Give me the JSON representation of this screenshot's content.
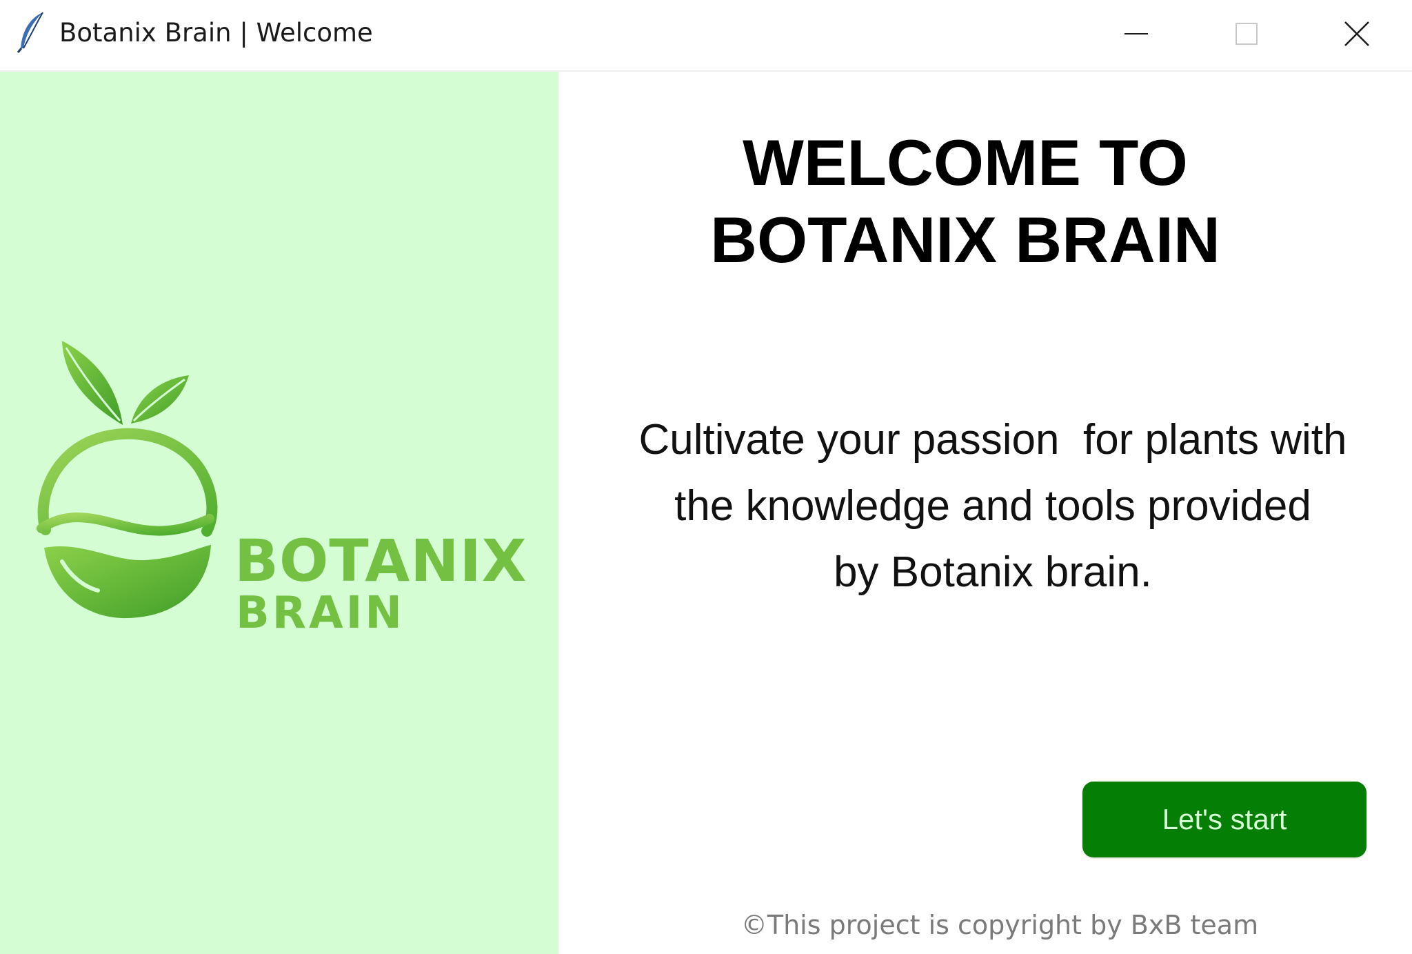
{
  "window": {
    "title": "Botanix Brain | Welcome",
    "app_icon": "feather-icon",
    "controls": {
      "minimize_icon": "minimize-icon",
      "maximize_icon": "maximize-icon",
      "close_icon": "close-icon"
    }
  },
  "left_panel": {
    "background": "#d4fdd4",
    "logo": {
      "icon": "apple-leaf-logo-icon",
      "word1": "BOTANIX",
      "word2": "BRAIN",
      "color": "#74c043"
    }
  },
  "main": {
    "heading_line1": "WELCOME TO",
    "heading_line2": "BOTANIX BRAIN",
    "description_line1": "Cultivate your passion  for plants with",
    "description_line2": "the knowledge and tools provided",
    "description_line3": "by Botanix brain.",
    "start_button": "Let's start",
    "start_button_color": "#047e04",
    "copyright": "©This project is copyright by BxB team"
  }
}
